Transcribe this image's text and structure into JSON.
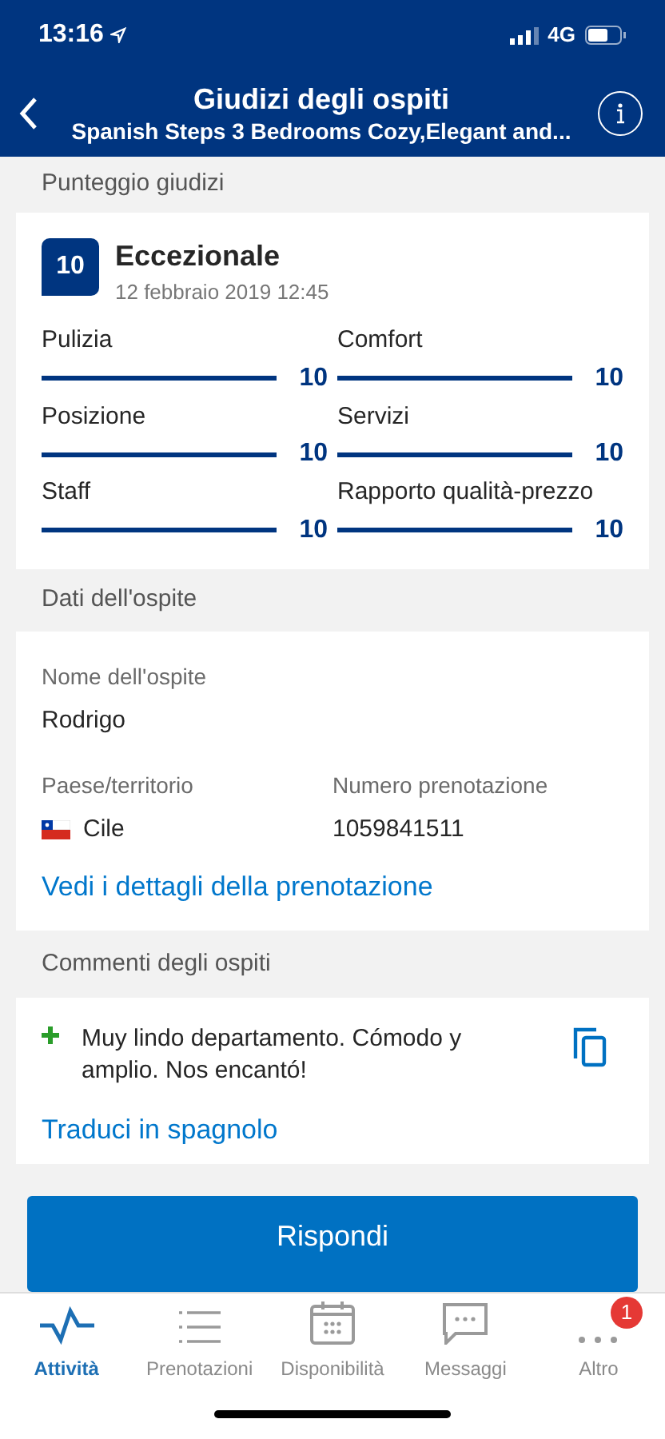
{
  "status_bar": {
    "time": "13:16",
    "network": "4G"
  },
  "header": {
    "title": "Giudizi degli ospiti",
    "subtitle": "Spanish Steps 3 Bedrooms Cozy,Elegant and..."
  },
  "score_section": {
    "heading": "Punteggio giudizi",
    "score": "10",
    "label": "Eccezionale",
    "date": "12 febbraio 2019 12:45",
    "categories": [
      {
        "name": "Pulizia",
        "level": 1,
        "value": "10"
      },
      {
        "name": "Comfort",
        "level": 1,
        "value": "10"
      },
      {
        "name": "Posizione",
        "level": 1,
        "value": "10"
      },
      {
        "name": "Servizi",
        "level": 1,
        "value": "10"
      },
      {
        "name": "Staff",
        "level": 1,
        "value": "10"
      },
      {
        "name": "Rapporto qualità-prezzo",
        "level": 1,
        "value": "10"
      }
    ]
  },
  "guest_section": {
    "heading": "Dati dell'ospite",
    "name_label": "Nome dell'ospite",
    "name": "Rodrigo",
    "country_label": "Paese/territorio",
    "country": "Cile",
    "booking_label": "Numero prenotazione",
    "booking_number": "1059841511",
    "details_link": "Vedi i dettagli della prenotazione"
  },
  "comments_section": {
    "heading": "Commenti degli ospiti",
    "comment": "Muy lindo departamento. Cómodo y amplio. Nos encantó!",
    "translate_link": "Traduci in spagnolo"
  },
  "reply_button": "Rispondi",
  "tab_bar": [
    {
      "label": "Attività",
      "selected": true
    },
    {
      "label": "Prenotazioni",
      "selected": false
    },
    {
      "label": "Disponibilità",
      "selected": false
    },
    {
      "label": "Messaggi",
      "selected": false
    },
    {
      "label": "Altro",
      "selected": false,
      "badge": "1"
    }
  ]
}
